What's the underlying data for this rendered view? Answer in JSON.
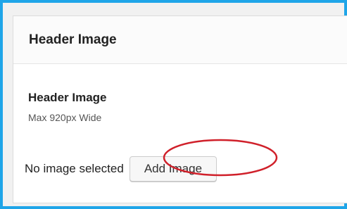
{
  "panel": {
    "title": "Header Image"
  },
  "field": {
    "label": "Header Image",
    "hint": "Max 920px Wide",
    "status": "No image selected",
    "add_button_label": "Add Image"
  },
  "colors": {
    "frame_border": "#1fa5e8",
    "highlight_ring": "#d0202a"
  }
}
